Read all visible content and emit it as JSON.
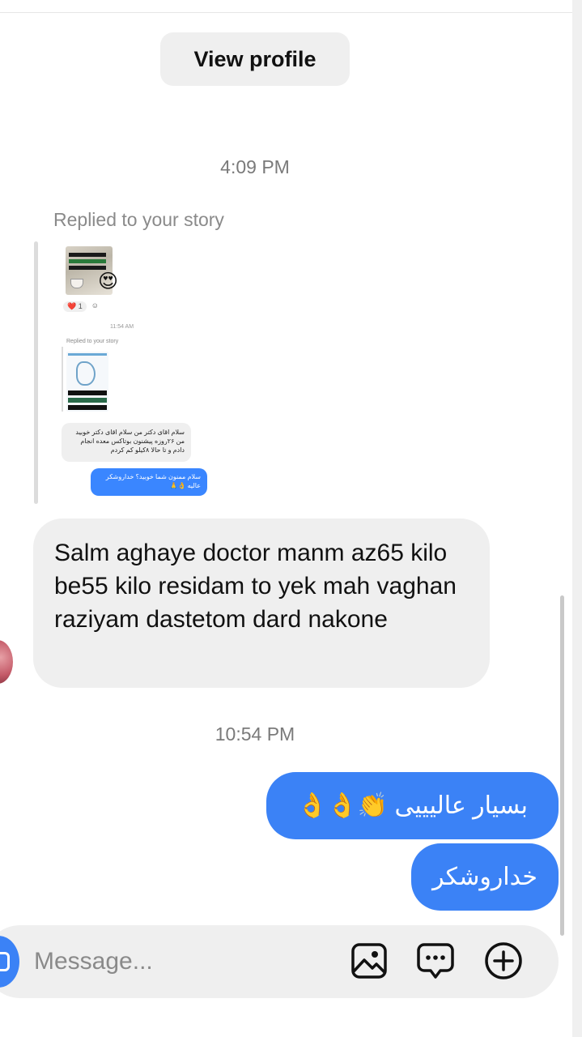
{
  "header": {
    "view_profile_label": "View profile"
  },
  "thread": {
    "timestamp_1": "4:09 PM",
    "story_reply_label": "Replied to your story",
    "story_preview": {
      "reaction_count": "1",
      "time": "11:54 AM",
      "replied_label": "Replied to your story",
      "received_text": "سلام اقای دکتر من سلام اقای دکتر خوبید من ۲۶روزه پیشنون بوتاکس معده انجام دادم و تا حالا ۸کیلو کم کردم",
      "sent_text": "سلام ممنون شما خوبید؟ خداروشکر عالیه 👌🙏"
    },
    "received_message": "Salm aghaye doctor manm az65 kilo be55 kilo residam to yek mah vaghan raziyam  dastetom dard nakone",
    "timestamp_2": "10:54 PM",
    "sent_messages": [
      "بسیار عالیییی 👏👌👌",
      "خداروشکر"
    ]
  },
  "composer": {
    "placeholder": "Message...",
    "icons": [
      "camera-icon",
      "gallery-icon",
      "sticker-icon",
      "plus-icon"
    ]
  },
  "colors": {
    "sent_bubble": "#3b82f6",
    "received_bubble": "#efefef",
    "timestamp_text": "#7a7a7a"
  }
}
